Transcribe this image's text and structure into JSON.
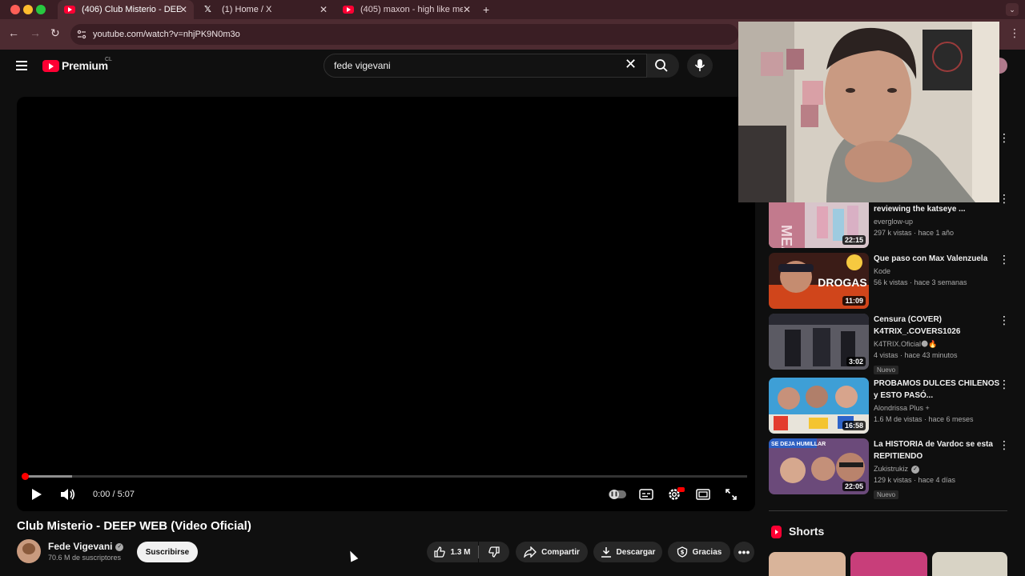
{
  "browser": {
    "tabs": [
      {
        "label": "(406) Club Misterio - DEEP W",
        "icon": "youtube-icon",
        "active": true
      },
      {
        "label": "(1) Home / X",
        "icon": "x-icon",
        "active": false
      },
      {
        "label": "(405) maxon - high like me (C",
        "icon": "youtube-icon",
        "active": false
      }
    ],
    "url": "youtube.com/watch?v=nhjPK9N0m3o"
  },
  "header": {
    "logo_text": "Premium",
    "country": "CL",
    "search_value": "fede vigevani"
  },
  "player": {
    "time": "0:00 / 5:07",
    "progress_played_fraction": 0.0,
    "progress_buffered_fraction": 0.066
  },
  "video": {
    "title": "Club Misterio - DEEP WEB (Video Oficial)",
    "channel": "Fede Vigevani",
    "subscribers": "70.6 M de suscriptores",
    "subscribe_label": "Suscribirse",
    "likes": "1.3 M",
    "share_label": "Compartir",
    "download_label": "Descargar",
    "thanks_label": "Gracias"
  },
  "sidebar": {
    "items": [
      {
        "title": "reviewing the katseye ...",
        "channel": "everglow-up",
        "stats": "297 k vistas · hace 1 año",
        "duration": "22:15",
        "badge": ""
      },
      {
        "title": "Que paso con Max Valenzuela",
        "channel": "Kode",
        "stats": "56 k vistas · hace 3 semanas",
        "duration": "11:09",
        "badge": ""
      },
      {
        "title": "Censura (COVER) K4TRIX_.COVERS1026",
        "channel": "K4TRIX.Oficial🌑🔥",
        "stats": "4 vistas · hace 43 minutos",
        "duration": "3:02",
        "badge": "Nuevo"
      },
      {
        "title": "PROBAMOS DULCES CHILENOS y ESTO PASÓ...",
        "channel": "Alondrissa Plus +",
        "stats": "1.6 M de vistas · hace 6 meses",
        "duration": "16:58",
        "badge": ""
      },
      {
        "title": "La HISTORIA de Vardoc se esta REPITIENDO",
        "channel": "Zukistrukiz",
        "stats": "129 k vistas · hace 4 días",
        "duration": "22:05",
        "badge": "Nuevo"
      }
    ],
    "thumb_texts": {
      "item1": "DROGAS",
      "item5": "SE DEJA HUMILLAR"
    },
    "shorts_title": "Shorts"
  },
  "colors": {
    "background": "#0f0f0f",
    "accent_red": "#ff0033",
    "tab_bar": "#3a1e24",
    "toolbar": "#4d2b31"
  }
}
